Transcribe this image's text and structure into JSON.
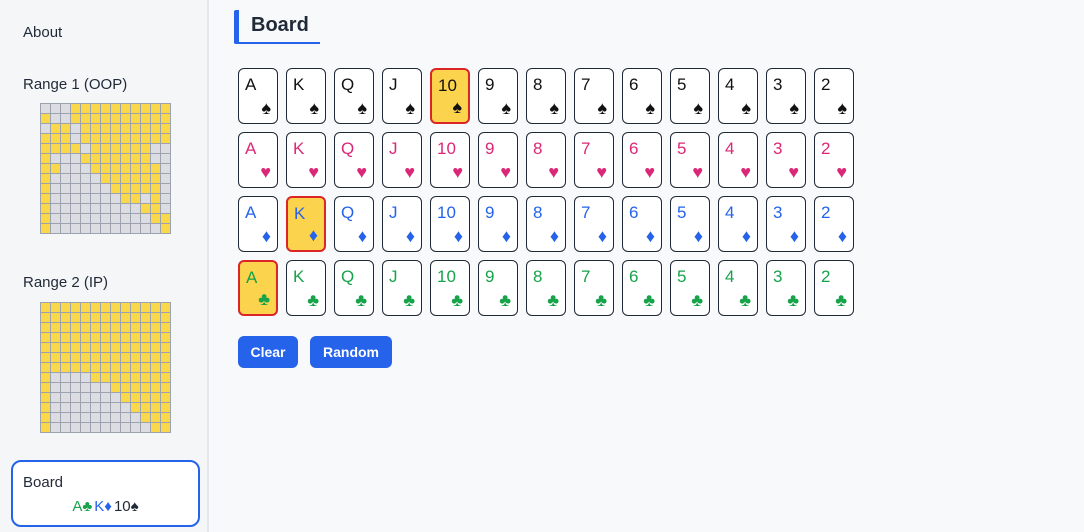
{
  "colors": {
    "accent": "#2563eb",
    "highlight": "#fcd34d",
    "selected_border": "#dc2626",
    "spades": "#111111",
    "hearts": "#db2777",
    "diamonds": "#2563eb",
    "clubs": "#16a34a"
  },
  "sidebar": {
    "about_label": "About",
    "range1_label": "Range 1 (OOP)",
    "range2_label": "Range 2 (IP)",
    "board_label": "Board",
    "board_cards": [
      {
        "rank": "A",
        "suit": "♣",
        "suit_name": "clubs"
      },
      {
        "rank": "K",
        "suit": "♦",
        "suit_name": "diamonds"
      },
      {
        "rank": "10",
        "suit": "♠",
        "suit_name": "spades"
      }
    ]
  },
  "main": {
    "title": "Board",
    "ranks": [
      "A",
      "K",
      "Q",
      "J",
      "10",
      "9",
      "8",
      "7",
      "6",
      "5",
      "4",
      "3",
      "2"
    ],
    "suits": [
      {
        "name": "spades",
        "symbol": "♠"
      },
      {
        "name": "hearts",
        "symbol": "♥"
      },
      {
        "name": "diamonds",
        "symbol": "♦"
      },
      {
        "name": "clubs",
        "symbol": "♣"
      }
    ],
    "selected_cards": [
      "10-spades",
      "K-diamonds",
      "A-clubs"
    ],
    "clear_label": "Clear",
    "random_label": "Random"
  },
  "range1_grid": [
    "0001111111111",
    "1001111111111",
    "0110111111111",
    "1110111111111",
    "1111011111100",
    "1000111111100",
    "1100011111110",
    "1000001111110",
    "1000000111110",
    "1000000011010",
    "1000000000110",
    "1000000000011",
    "1000000000001"
  ],
  "range2_grid": [
    "1111111111111",
    "1111111111111",
    "1111111111111",
    "1111111111111",
    "1111111111111",
    "1111111111111",
    "1111111111111",
    "1000011111111",
    "1000000111111",
    "1000000011111",
    "1000000001111",
    "1000000000111",
    "1000000000011"
  ]
}
